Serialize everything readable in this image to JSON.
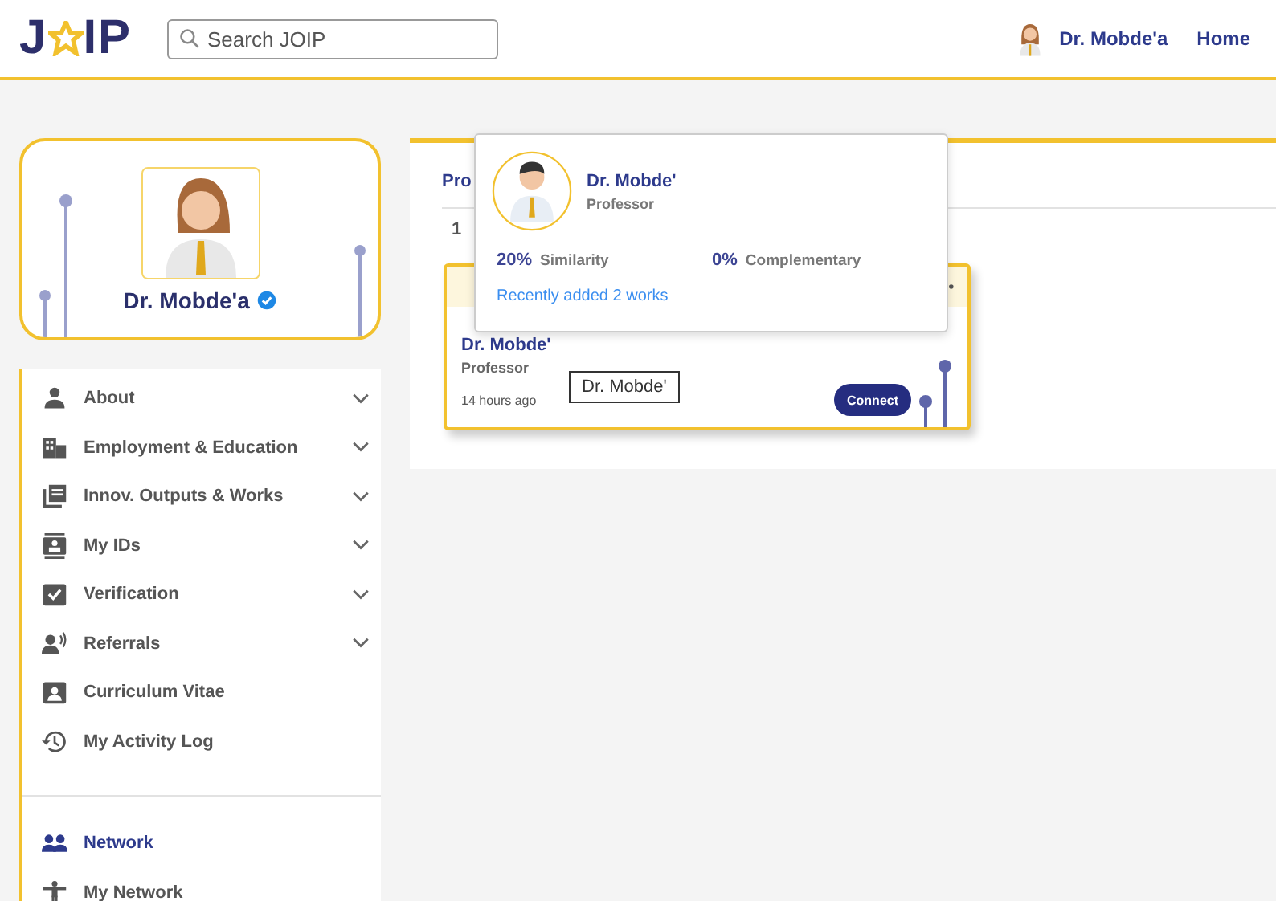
{
  "header": {
    "logo_start": "J",
    "logo_end": "IP",
    "search": {
      "placeholder": "Search JOIP"
    },
    "user": "Dr. Mobde'a",
    "home": "Home"
  },
  "profile": {
    "name": "Dr. Mobde'a",
    "verified": true
  },
  "menu": [
    {
      "label": "About",
      "expandable": true,
      "selected": false
    },
    {
      "label": "Employment & Education",
      "expandable": true,
      "selected": false
    },
    {
      "label": "Innov. Outputs & Works",
      "expandable": true,
      "selected": false
    },
    {
      "label": "My IDs",
      "expandable": true,
      "selected": false
    },
    {
      "label": "Verification",
      "expandable": true,
      "selected": false
    },
    {
      "label": "Referrals",
      "expandable": true,
      "selected": false
    },
    {
      "label": "Curriculum Vitae",
      "expandable": false,
      "selected": false
    },
    {
      "label": "My Activity Log",
      "expandable": false,
      "selected": false
    }
  ],
  "menu_2": [
    {
      "label": "Network",
      "selected": true
    },
    {
      "label": "My Network",
      "selected": false
    }
  ],
  "panel": {
    "heading": "Pro",
    "count": "1",
    "card": {
      "name": "Dr. Mobde'",
      "role": "Professor",
      "time": "14 hours ago",
      "tooltip": "Dr. Mobde'",
      "button": "Connect"
    }
  },
  "popup": {
    "name": "Dr. Mobde'",
    "role": "Professor",
    "similarity": "20%",
    "similarity_label": "Similarity",
    "complementary": "0%",
    "complementary_label": "Complementary",
    "recent": "Recently added 2 works"
  }
}
